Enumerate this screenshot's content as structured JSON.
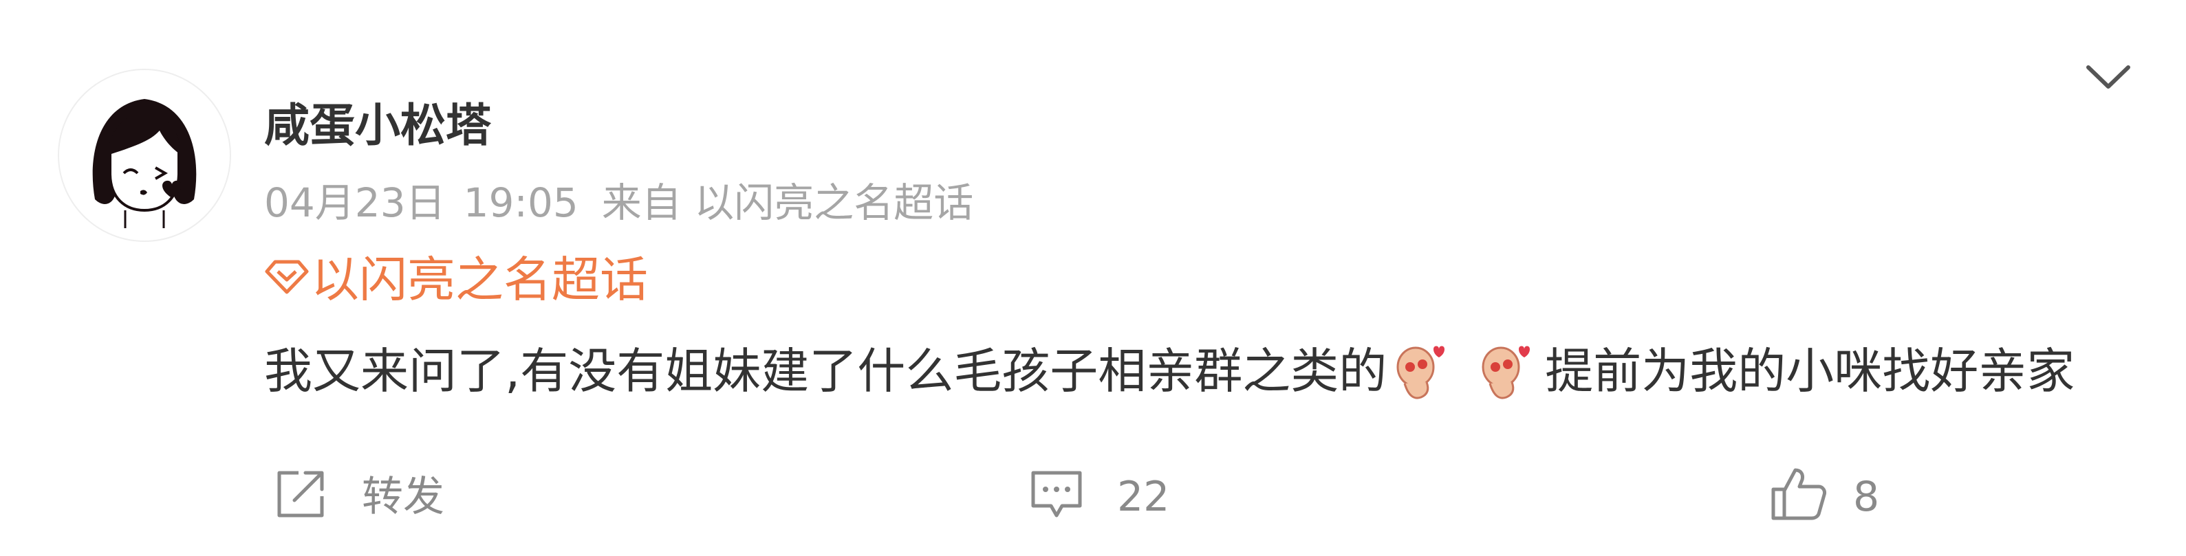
{
  "post": {
    "username": "咸蛋小松塔",
    "date": "04月23日",
    "time": "19:05",
    "source": "来自 以闪亮之名超话",
    "topic": "以闪亮之名超话",
    "text_before_emoji": "我又来问了,有没有姐妹建了什么毛孩子相亲群之类的",
    "text_after_emoji": "提前为我的小咪找好亲家",
    "emojis": [
      "heart-eyes-emoji",
      "heart-eyes-emoji"
    ]
  },
  "actions": {
    "repost_label": "转发",
    "comment_count": "22",
    "like_count": "8"
  },
  "colors": {
    "topic_accent": "#ee7a45",
    "meta_gray": "#a6a6a6",
    "text": "#333333",
    "icon_gray": "#8a8a8a"
  }
}
